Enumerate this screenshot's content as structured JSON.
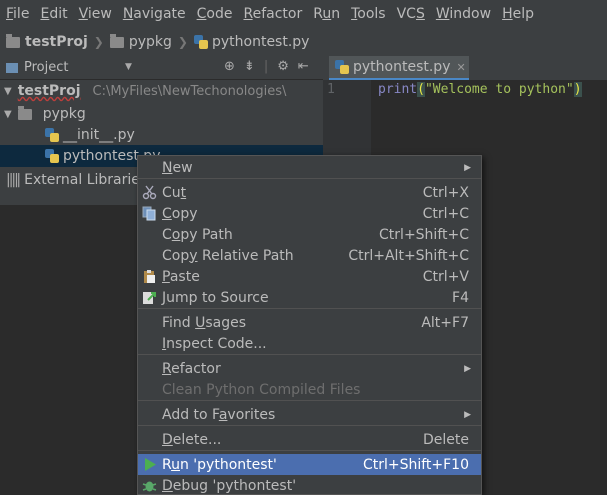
{
  "menubar": {
    "items": [
      {
        "pre": "",
        "u": "F",
        "post": "ile"
      },
      {
        "pre": "",
        "u": "E",
        "post": "dit"
      },
      {
        "pre": "",
        "u": "V",
        "post": "iew"
      },
      {
        "pre": "",
        "u": "N",
        "post": "avigate"
      },
      {
        "pre": "",
        "u": "C",
        "post": "ode"
      },
      {
        "pre": "",
        "u": "R",
        "post": "efactor"
      },
      {
        "pre": "R",
        "u": "u",
        "post": "n"
      },
      {
        "pre": "",
        "u": "T",
        "post": "ools"
      },
      {
        "pre": "VC",
        "u": "S",
        "post": ""
      },
      {
        "pre": "",
        "u": "W",
        "post": "indow"
      },
      {
        "pre": "",
        "u": "H",
        "post": "elp"
      }
    ]
  },
  "breadcrumb": {
    "project": "testProj",
    "package": "pypkg",
    "file": "pythontest.py"
  },
  "project_panel": {
    "title": "Project",
    "root": "testProj",
    "root_path": "C:\\MyFiles\\NewTechonologies\\",
    "package": "pypkg",
    "files": [
      "__init__.py",
      "pythontest.py"
    ],
    "external": "External Libraries"
  },
  "editor": {
    "tab_label": "pythontest.py",
    "line_number": "1",
    "code": {
      "func": "print",
      "open": "(",
      "string": "\"Welcome to python\"",
      "close": ")"
    }
  },
  "context_menu": {
    "items": [
      {
        "label_pre": "",
        "label_u": "N",
        "label_post": "ew",
        "shortcut": "",
        "submenu": true
      },
      {
        "label_pre": "Cu",
        "label_u": "t",
        "label_post": "",
        "shortcut": "Ctrl+X",
        "icon": "scissors-icon"
      },
      {
        "label_pre": "",
        "label_u": "C",
        "label_post": "opy",
        "shortcut": "Ctrl+C",
        "icon": "copy-icon"
      },
      {
        "label_pre": "C",
        "label_u": "o",
        "label_post": "py Path",
        "shortcut": "Ctrl+Shift+C"
      },
      {
        "label_pre": "Cop",
        "label_u": "y",
        "label_post": " Relative Path",
        "shortcut": "Ctrl+Alt+Shift+C"
      },
      {
        "label_pre": "",
        "label_u": "P",
        "label_post": "aste",
        "shortcut": "Ctrl+V",
        "icon": "paste-icon"
      },
      {
        "label_pre": "",
        "label_u": "J",
        "label_post": "ump to Source",
        "shortcut": "F4",
        "icon": "jump-to-source-icon"
      },
      {
        "label_pre": "Find ",
        "label_u": "U",
        "label_post": "sages",
        "shortcut": "Alt+F7"
      },
      {
        "label_pre": "",
        "label_u": "I",
        "label_post": "nspect Code...",
        "shortcut": ""
      },
      {
        "label_pre": "",
        "label_u": "R",
        "label_post": "efactor",
        "shortcut": "",
        "submenu": true
      },
      {
        "label_pre": "Clean Python Compiled Files",
        "label_u": "",
        "label_post": "",
        "shortcut": "",
        "disabled": true
      },
      {
        "label_pre": "Add to F",
        "label_u": "a",
        "label_post": "vorites",
        "shortcut": "",
        "submenu": true
      },
      {
        "label_pre": "",
        "label_u": "D",
        "label_post": "elete...",
        "shortcut": "Delete"
      },
      {
        "label_pre": "R",
        "label_u": "u",
        "label_post": "n 'pythontest'",
        "shortcut": "Ctrl+Shift+F10",
        "highlighted": true,
        "icon": "run-icon"
      },
      {
        "label_pre": "",
        "label_u": "D",
        "label_post": "ebug 'pythontest'",
        "shortcut": "",
        "icon": "debug-icon"
      }
    ]
  },
  "colors": {
    "background": "#2b2b2b",
    "panel": "#3c3f41",
    "highlight": "#4b6eaf",
    "selection": "#0d293e"
  }
}
